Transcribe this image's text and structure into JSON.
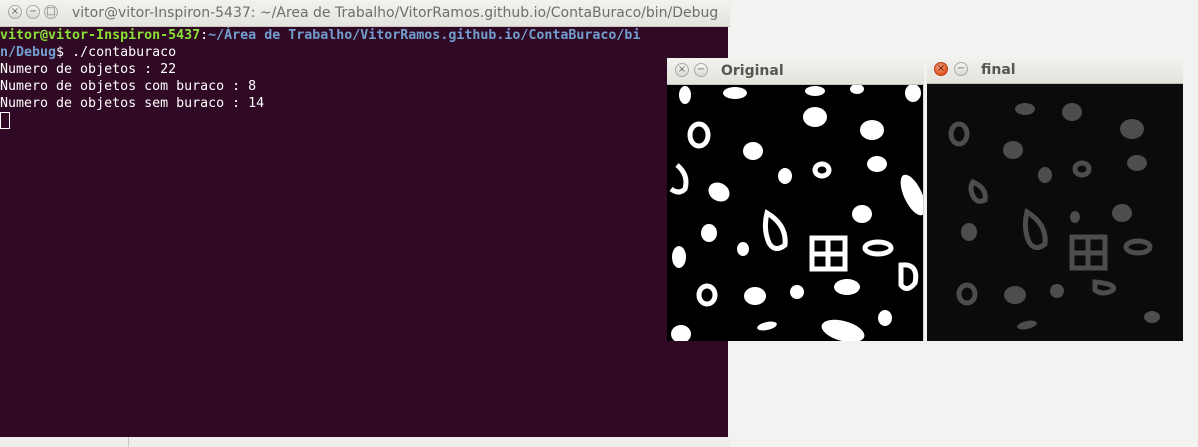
{
  "terminal": {
    "title": "vitor@vitor-Inspiron-5437: ~/Área de Trabalho/VitorRamos.github.io/ContaBuraco/bin/Debug",
    "prompt_user": "vitor@vitor-Inspiron-5437",
    "prompt_sep": ":",
    "prompt_path": "~/Área de Trabalho/VitorRamos.github.io/ContaBuraco/bi",
    "prompt_path_cont": "n/Debug",
    "prompt_end": "$ ",
    "command": "./contaburaco",
    "output": [
      "Numero de objetos : 22",
      "Numero de objetos com buraco : 8",
      "Numero de objetos sem buraco : 14"
    ]
  },
  "original_window": {
    "title": "Original"
  },
  "final_window": {
    "title": "final"
  },
  "controls": {
    "close_glyph": "×",
    "minimize_glyph": "−",
    "maximize_glyph": "□"
  },
  "colors": {
    "terminal_bg": "#300a24",
    "prompt_user": "#8ae234",
    "prompt_path": "#729fcf",
    "final_bg": "#0b0b0b",
    "close_active": "#e2531f"
  }
}
